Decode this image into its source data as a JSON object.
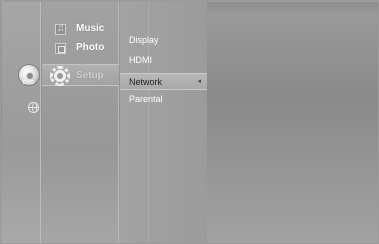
{
  "source_menu": {
    "items": [
      {
        "name": "dvd",
        "label": "DVD",
        "icon": "disc-icon"
      },
      {
        "name": "internet",
        "label": "",
        "icon": "globe-icon"
      }
    ]
  },
  "main_menu": {
    "items": [
      {
        "label": "Music",
        "icon": "music-note-icon"
      },
      {
        "label": "Photo",
        "icon": "photo-icon"
      },
      {
        "label": "Setup",
        "icon": "gear-icon",
        "selected": true
      }
    ]
  },
  "sub_menu": {
    "items": [
      {
        "label": "Display"
      },
      {
        "label": "HDMI"
      },
      {
        "label": "Network",
        "highlighted": true,
        "arrow": "◂"
      },
      {
        "label": "Parental"
      }
    ]
  },
  "colors": {
    "background": "#9a9a9a",
    "highlight": "#b8b8b8",
    "text": "#ffffff",
    "selected_text": "#222222"
  }
}
